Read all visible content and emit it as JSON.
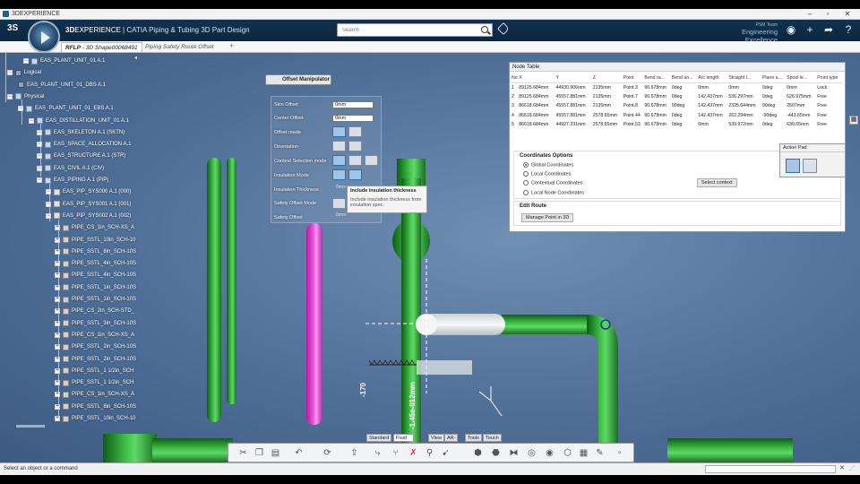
{
  "window": {
    "title": "3DEXPERIENCE"
  },
  "header": {
    "brand_bold": "3D",
    "brand_rest": "EXPERIENCE",
    "app_sep": " | ",
    "app_name": "CATIA Piping & Tubing 3D Part Design",
    "search_placeholder": "Search",
    "user_name": "PSM Team",
    "role": "Engineering Excellence"
  },
  "tabs": {
    "active_bold": "RFLP",
    "active_rest": " - 3D Shape00068491",
    "second": "Piping Safety Route Offset"
  },
  "tree": [
    {
      "label": "EAS_PLANT_UNIT_01 A.1",
      "icon": "product"
    },
    {
      "label": "Logical",
      "icon": "logic"
    },
    {
      "label": "EAS_PLANT_UNIT_01_DBS A.1",
      "icon": "logic"
    },
    {
      "label": "Physical",
      "icon": "product"
    },
    {
      "label": "EAS_PLANT_UNIT_01_EBS A.1",
      "icon": "product"
    },
    {
      "label": "EAS_DISTILLATION_UNIT_01 A.1",
      "icon": "product"
    },
    {
      "label": "EAS_SKELETON A.1 (SKTN)",
      "icon": "product"
    },
    {
      "label": "EAS_SPACE_ALLOCATION A.1",
      "icon": "product"
    },
    {
      "label": "EAS_STRUCTURE A.1 (STR)",
      "icon": "product"
    },
    {
      "label": "EAS_CIVIL A.1 (CIV)",
      "icon": "product"
    },
    {
      "label": "EAS_PIPING A.1 (PIP)",
      "icon": "product"
    },
    {
      "label": "EAS_PIP_SYS000 A.1 (000)",
      "icon": "sys"
    },
    {
      "label": "EAS_PIP_SYS001 A.1 (001)",
      "icon": "sys"
    },
    {
      "label": "EAS_PIP_SYS002 A.1 (002)",
      "icon": "sys"
    },
    {
      "label": "PIPE_CS_1in_SCH-XS_A",
      "icon": "pipe"
    },
    {
      "label": "PIPE_SSTL_10in_SCH-10",
      "icon": "pipe"
    },
    {
      "label": "PIPE_SSTL_8in_SCH-10S",
      "icon": "pipe"
    },
    {
      "label": "PIPE_SSTL_4in_SCH-10S",
      "icon": "pipe"
    },
    {
      "label": "PIPE_SSTL_4in_SCH-10S",
      "icon": "pipe"
    },
    {
      "label": "PIPE_SSTL_1in_SCH-10S",
      "icon": "pipe"
    },
    {
      "label": "PIPE_SSTL_1in_SCH-10S",
      "icon": "pipe"
    },
    {
      "label": "PIPE_CS_2in_SCH-STD_",
      "icon": "pipe"
    },
    {
      "label": "PIPE_SSTL_3in_SCH-10S",
      "icon": "pipe"
    },
    {
      "label": "PIPE_CS_1in_SCH-XS_A",
      "icon": "pipe"
    },
    {
      "label": "PIPE_SSTL_2in_SCH-10S",
      "icon": "pipe"
    },
    {
      "label": "PIPE_SSTL_2in_SCH-10S",
      "icon": "pipe"
    },
    {
      "label": "PIPE_SSTL_1 1/2in_SCH",
      "icon": "pipe"
    },
    {
      "label": "PIPE_SSTL_1 1/2in_SCH",
      "icon": "pipe"
    },
    {
      "label": "PIPE_CS_1in_SCH-XS_A",
      "icon": "pipe"
    },
    {
      "label": "PIPE_SSTL_8in_SCH-10S",
      "icon": "pipe"
    },
    {
      "label": "PIPE_SSTL_10in_SCH-10",
      "icon": "pipe"
    }
  ],
  "offset_manipulator": {
    "title": "Offset Manipulator",
    "skin_offset_label": "Skin Offset",
    "skin_offset_value": "0mm",
    "center_offset_label": "Center Offset",
    "center_offset_value": "0mm",
    "offset_mode_label": "Offset mode",
    "orientation_label": "Orientation",
    "context_selection_label": "Context Selection mode",
    "insulation_mode_label": "Insulation Mode",
    "insulation_thickness_label": "Insulation Thickness",
    "insulation_thickness_value": "0mm",
    "safety_offset_mode_label": "Safety Offset Mode",
    "safety_offset_label": "Safety Offset",
    "safety_offset_value": "0mm"
  },
  "tooltip": {
    "title": "Include insulation thickness",
    "desc": "Include insulation thickness from insulation spec."
  },
  "node_table": {
    "title": "Node Table",
    "columns": [
      "No",
      "X",
      "Y",
      "Z",
      "Point",
      "Bend ra...",
      "Bend an...",
      "Arc length",
      "Straight l...",
      "Plane a...",
      "Spool le...",
      "Point type"
    ],
    "rows": [
      [
        "1",
        "89125.684mm",
        "44930.906mm",
        "2135mm",
        "Point.3",
        "90.678mm",
        "0deg",
        "0mm",
        "0mm",
        "0deg",
        "0mm",
        "Lock"
      ],
      [
        "2",
        "89125.684mm",
        "45557.881mm",
        "2135mm",
        "Point.7",
        "90.678mm",
        "0deg",
        "142.437mm",
        "536.297mm",
        "0deg",
        "626.975mm",
        "Free"
      ],
      [
        "3",
        "86618.684mm",
        "45557.881mm",
        "2135mm",
        "Point.8",
        "90.678mm",
        "90deg",
        "142.437mm",
        "2325.644mm",
        "90deg",
        "2507mm",
        "Free"
      ],
      [
        "4",
        "86618.684mm",
        "45557.881mm",
        "2578.65mm",
        "Point.44",
        "90.678mm",
        "0deg",
        "142.437mm",
        "262.294mm",
        "-90deg",
        "-443.65mm",
        "Free"
      ],
      [
        "5",
        "86618.684mm",
        "44927.231mm",
        "2578.65mm",
        "Point.53",
        "90.678mm",
        "0deg",
        "0mm",
        "539.972mm",
        "0deg",
        "630.65mm",
        "Free"
      ]
    ],
    "coord_title": "Coordinates Options",
    "coord_options": [
      "Global Coordinates",
      "Local Coordinates",
      "Contextual Coordinates",
      "Local Node Coordinates"
    ],
    "select_context": "Select context",
    "edit_route_title": "Edit Route",
    "manage_point": "Manage Point in 3D"
  },
  "action_pad": {
    "title": "Action Pad"
  },
  "dims": {
    "d1": "-170",
    "d2": "-1.45e-012mm"
  },
  "bottom_tabs": [
    "Standard",
    "Fluid Design",
    "View",
    "AR-VR",
    "Tools",
    "Touch"
  ],
  "status": {
    "text": "Select an object or a command"
  },
  "colors": {
    "header": "#12324f",
    "pipe": "#3cb844",
    "highlight_pipe": "#e23bd5",
    "viewport": "#5a7aa2"
  }
}
